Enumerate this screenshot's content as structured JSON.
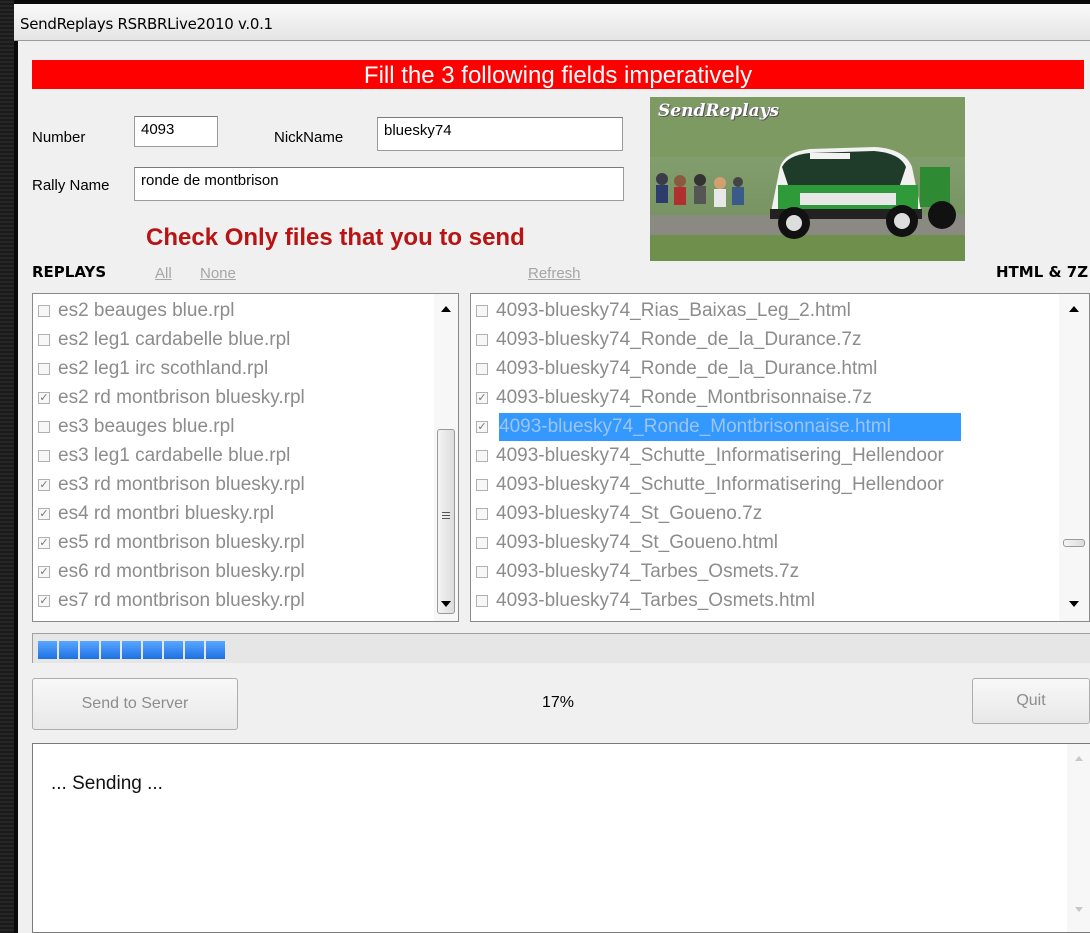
{
  "window": {
    "title": "SendReplays RSRBRLive2010 v.0.1"
  },
  "banner": {
    "text": "Fill the 3 following fields imperatively",
    "color": "#ff0000"
  },
  "form": {
    "number_label": "Number",
    "number_value": "4093",
    "nick_label": "NickName",
    "nick_value": "bluesky74",
    "rally_label": "Rally Name",
    "rally_value": "ronde de montbrison"
  },
  "image": {
    "caption": "SendReplays"
  },
  "instruction": {
    "text": "Check Only files that you to send",
    "color": "#b81414"
  },
  "replays": {
    "header": "REPLAYS",
    "all_link": "All",
    "none_link": "None",
    "items": [
      {
        "label": "es2 beauges blue.rpl",
        "checked": false
      },
      {
        "label": "es2 leg1 cardabelle blue.rpl",
        "checked": false
      },
      {
        "label": "es2 leg1 irc scothland.rpl",
        "checked": false
      },
      {
        "label": "es2 rd montbrison bluesky.rpl",
        "checked": true
      },
      {
        "label": "es3 beauges blue.rpl",
        "checked": false
      },
      {
        "label": "es3 leg1 cardabelle blue.rpl",
        "checked": false
      },
      {
        "label": "es3 rd montbrison bluesky.rpl",
        "checked": true
      },
      {
        "label": "es4 rd montbri bluesky.rpl",
        "checked": true
      },
      {
        "label": "es5 rd montbrison bluesky.rpl",
        "checked": true
      },
      {
        "label": "es6 rd montbrison bluesky.rpl",
        "checked": true
      },
      {
        "label": "es7 rd montbrison bluesky.rpl",
        "checked": true
      }
    ]
  },
  "html7z": {
    "header": "HTML & 7Z",
    "refresh_link": "Refresh",
    "items": [
      {
        "label": "4093-bluesky74_Rias_Baixas_Leg_2.html",
        "checked": false,
        "selected": false
      },
      {
        "label": "4093-bluesky74_Ronde_de_la_Durance.7z",
        "checked": false,
        "selected": false
      },
      {
        "label": "4093-bluesky74_Ronde_de_la_Durance.html",
        "checked": false,
        "selected": false
      },
      {
        "label": "4093-bluesky74_Ronde_Montbrisonnaise.7z",
        "checked": true,
        "selected": false
      },
      {
        "label": "4093-bluesky74_Ronde_Montbrisonnaise.html",
        "checked": true,
        "selected": true
      },
      {
        "label": "4093-bluesky74_Schutte_Informatisering_Hellendoor",
        "checked": false,
        "selected": false
      },
      {
        "label": "4093-bluesky74_Schutte_Informatisering_Hellendoor",
        "checked": false,
        "selected": false
      },
      {
        "label": "4093-bluesky74_St_Goueno.7z",
        "checked": false,
        "selected": false
      },
      {
        "label": "4093-bluesky74_St_Goueno.html",
        "checked": false,
        "selected": false
      },
      {
        "label": "4093-bluesky74_Tarbes_Osmets.7z",
        "checked": false,
        "selected": false
      },
      {
        "label": "4093-bluesky74_Tarbes_Osmets.html",
        "checked": false,
        "selected": false
      }
    ]
  },
  "progress": {
    "filled_segments": 9,
    "percent_text": "17%",
    "color": "#1c70e4"
  },
  "buttons": {
    "send_label": "Send to Server",
    "quit_label": "Quit"
  },
  "log": {
    "text": "... Sending ..."
  }
}
